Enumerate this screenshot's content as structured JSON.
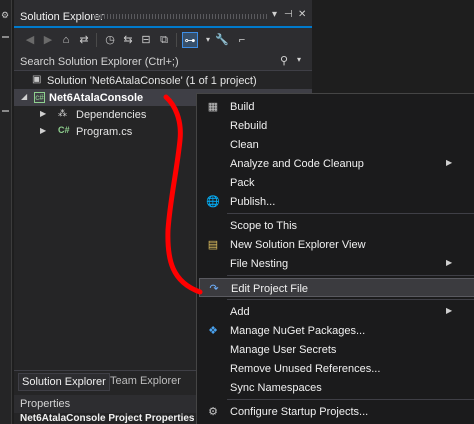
{
  "explorer": {
    "title": "Solution Explorer",
    "title_buttons": [
      "▾",
      "⊣",
      "✕"
    ],
    "search_placeholder": "Search Solution Explorer (Ctrl+;)",
    "tree": {
      "solution": "Solution 'Net6AtalaConsole' (1 of 1 project)",
      "project": "Net6AtalaConsole",
      "dependencies": "Dependencies",
      "program": "Program.cs"
    },
    "bottom_tabs": [
      "Solution Explorer",
      "Team Explorer"
    ],
    "properties": {
      "title": "Properties",
      "subtitle": "Net6AtalaConsole  Project Properties"
    }
  },
  "menu": {
    "items": {
      "build": "Build",
      "rebuild": "Rebuild",
      "clean": "Clean",
      "analyze": "Analyze and Code Cleanup",
      "pack": "Pack",
      "publish": "Publish...",
      "scope": "Scope to This",
      "new_view": "New Solution Explorer View",
      "file_nesting": "File Nesting",
      "edit_project": "Edit Project File",
      "add": "Add",
      "nuget": "Manage NuGet Packages...",
      "user_secrets": "Manage User Secrets",
      "remove_refs": "Remove Unused References...",
      "sync_ns": "Sync Namespaces",
      "startup": "Configure Startup Projects..."
    }
  },
  "colors": {
    "accent": "#007acc",
    "annotation": "#ff0000",
    "menu_bg": "#1b1b1c",
    "panel_bg": "#252526"
  },
  "icons": {
    "title": [
      "dropdown-icon",
      "pin-icon",
      "close-icon"
    ],
    "toolbar": [
      "back-icon",
      "forward-icon",
      "home-icon",
      "switch-views-icon",
      "history-icon",
      "sync-icon",
      "collapse-all-icon",
      "show-all-files-icon",
      "filter-icon",
      "properties-icon",
      "preview-icon"
    ],
    "menu": [
      "build-icon",
      "publish-icon",
      "new-view-icon",
      "edit-file-icon",
      "nuget-icon",
      "settings-icon"
    ]
  }
}
